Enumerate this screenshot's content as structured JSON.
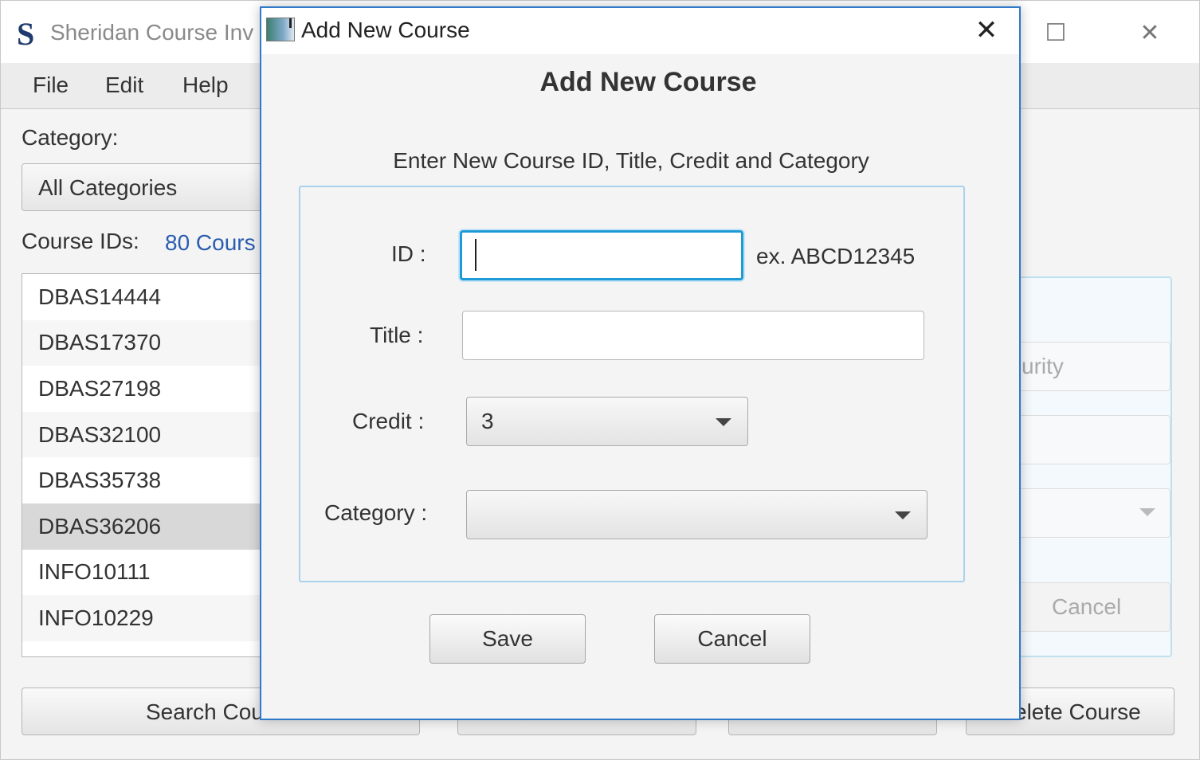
{
  "main_window": {
    "logo": "S",
    "title": "Sheridan Course Inv",
    "controls": {
      "maximize": "☐",
      "close": "✕"
    },
    "menu": [
      "File",
      "Edit",
      "Help"
    ],
    "category_label": "Category:",
    "category_value": "All Categories",
    "course_ids_label": "Course IDs:",
    "course_count": "80 Cours",
    "course_ids": [
      "DBAS14444",
      "DBAS17370",
      "DBAS27198",
      "DBAS32100",
      "DBAS35738",
      "DBAS36206",
      "INFO10111",
      "INFO10229"
    ],
    "selected_course": "DBAS36206",
    "right_panel": {
      "field1_text": "urity",
      "cancel_label": "Cancel"
    },
    "bottom_buttons": {
      "search": "Search Cou",
      "delete": "elete Course"
    }
  },
  "dialog": {
    "window_title": "Add New Course",
    "close_glyph": "✕",
    "heading": "Add New Course",
    "instructions": "Enter New Course ID, Title, Credit and Category",
    "form": {
      "id_label": "ID :",
      "id_value": "",
      "id_hint": "ex. ABCD12345",
      "title_label": "Title :",
      "title_value": "",
      "credit_label": "Credit :",
      "credit_value": "3",
      "category_label": "Category :",
      "category_value": ""
    },
    "buttons": {
      "save": "Save",
      "cancel": "Cancel"
    }
  },
  "colors": {
    "accent_focus": "#1e9ad6",
    "dialog_border": "#2f79c9",
    "link_blue": "#2a5db0",
    "selection": "#d8d8d8"
  },
  "icons": [
    "app-logo-icon",
    "dialog-app-icon",
    "close-icon",
    "maximize-icon",
    "chevron-down-icon"
  ]
}
